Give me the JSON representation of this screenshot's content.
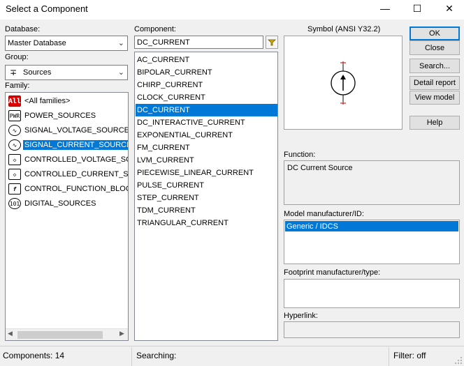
{
  "window": {
    "title": "Select a Component",
    "minimize_glyph": "—",
    "maximize_glyph": "☐",
    "close_glyph": "✕"
  },
  "database": {
    "label": "Database:",
    "value": "Master Database"
  },
  "group": {
    "label": "Group:",
    "value": "Sources",
    "icon_glyph": "∓"
  },
  "family": {
    "label": "Family:",
    "items": [
      {
        "label": "<All families>",
        "icon": "All"
      },
      {
        "label": "POWER_SOURCES",
        "icon": "PWR"
      },
      {
        "label": "SIGNAL_VOLTAGE_SOURCES",
        "icon": "∿"
      },
      {
        "label": "SIGNAL_CURRENT_SOURCES",
        "icon": "∿"
      },
      {
        "label": "CONTROLLED_VOLTAGE_SOUR",
        "icon": "◇"
      },
      {
        "label": "CONTROLLED_CURRENT_SOUI",
        "icon": "◇"
      },
      {
        "label": "CONTROL_FUNCTION_BLOCKS",
        "icon": "f"
      },
      {
        "label": "DIGITAL_SOURCES",
        "icon": "101"
      }
    ],
    "selected_index": 3
  },
  "component": {
    "label": "Component:",
    "value": "DC_CURRENT",
    "filter_icon": "filter-icon",
    "items": [
      "AC_CURRENT",
      "BIPOLAR_CURRENT",
      "CHIRP_CURRENT",
      "CLOCK_CURRENT",
      "DC_CURRENT",
      "DC_INTERACTIVE_CURRENT",
      "EXPONENTIAL_CURRENT",
      "FM_CURRENT",
      "LVM_CURRENT",
      "PIECEWISE_LINEAR_CURRENT",
      "PULSE_CURRENT",
      "STEP_CURRENT",
      "TDM_CURRENT",
      "TRIANGULAR_CURRENT"
    ],
    "selected_index": 4
  },
  "symbol": {
    "label": "Symbol (ANSI Y32.2)"
  },
  "buttons": {
    "ok": "OK",
    "close": "Close",
    "search": "Search...",
    "detail_report": "Detail report",
    "view_model": "View model",
    "help": "Help"
  },
  "function": {
    "label": "Function:",
    "value": "DC Current Source"
  },
  "model": {
    "label": "Model manufacturer/ID:",
    "value": "Generic / IDCS"
  },
  "footprint": {
    "label": "Footprint manufacturer/type:"
  },
  "hyperlink": {
    "label": "Hyperlink:"
  },
  "status": {
    "components": "Components: 14",
    "searching": "Searching:",
    "filter": "Filter: off"
  },
  "colors": {
    "selection": "#0078d7",
    "all_icon": "#e00000"
  }
}
